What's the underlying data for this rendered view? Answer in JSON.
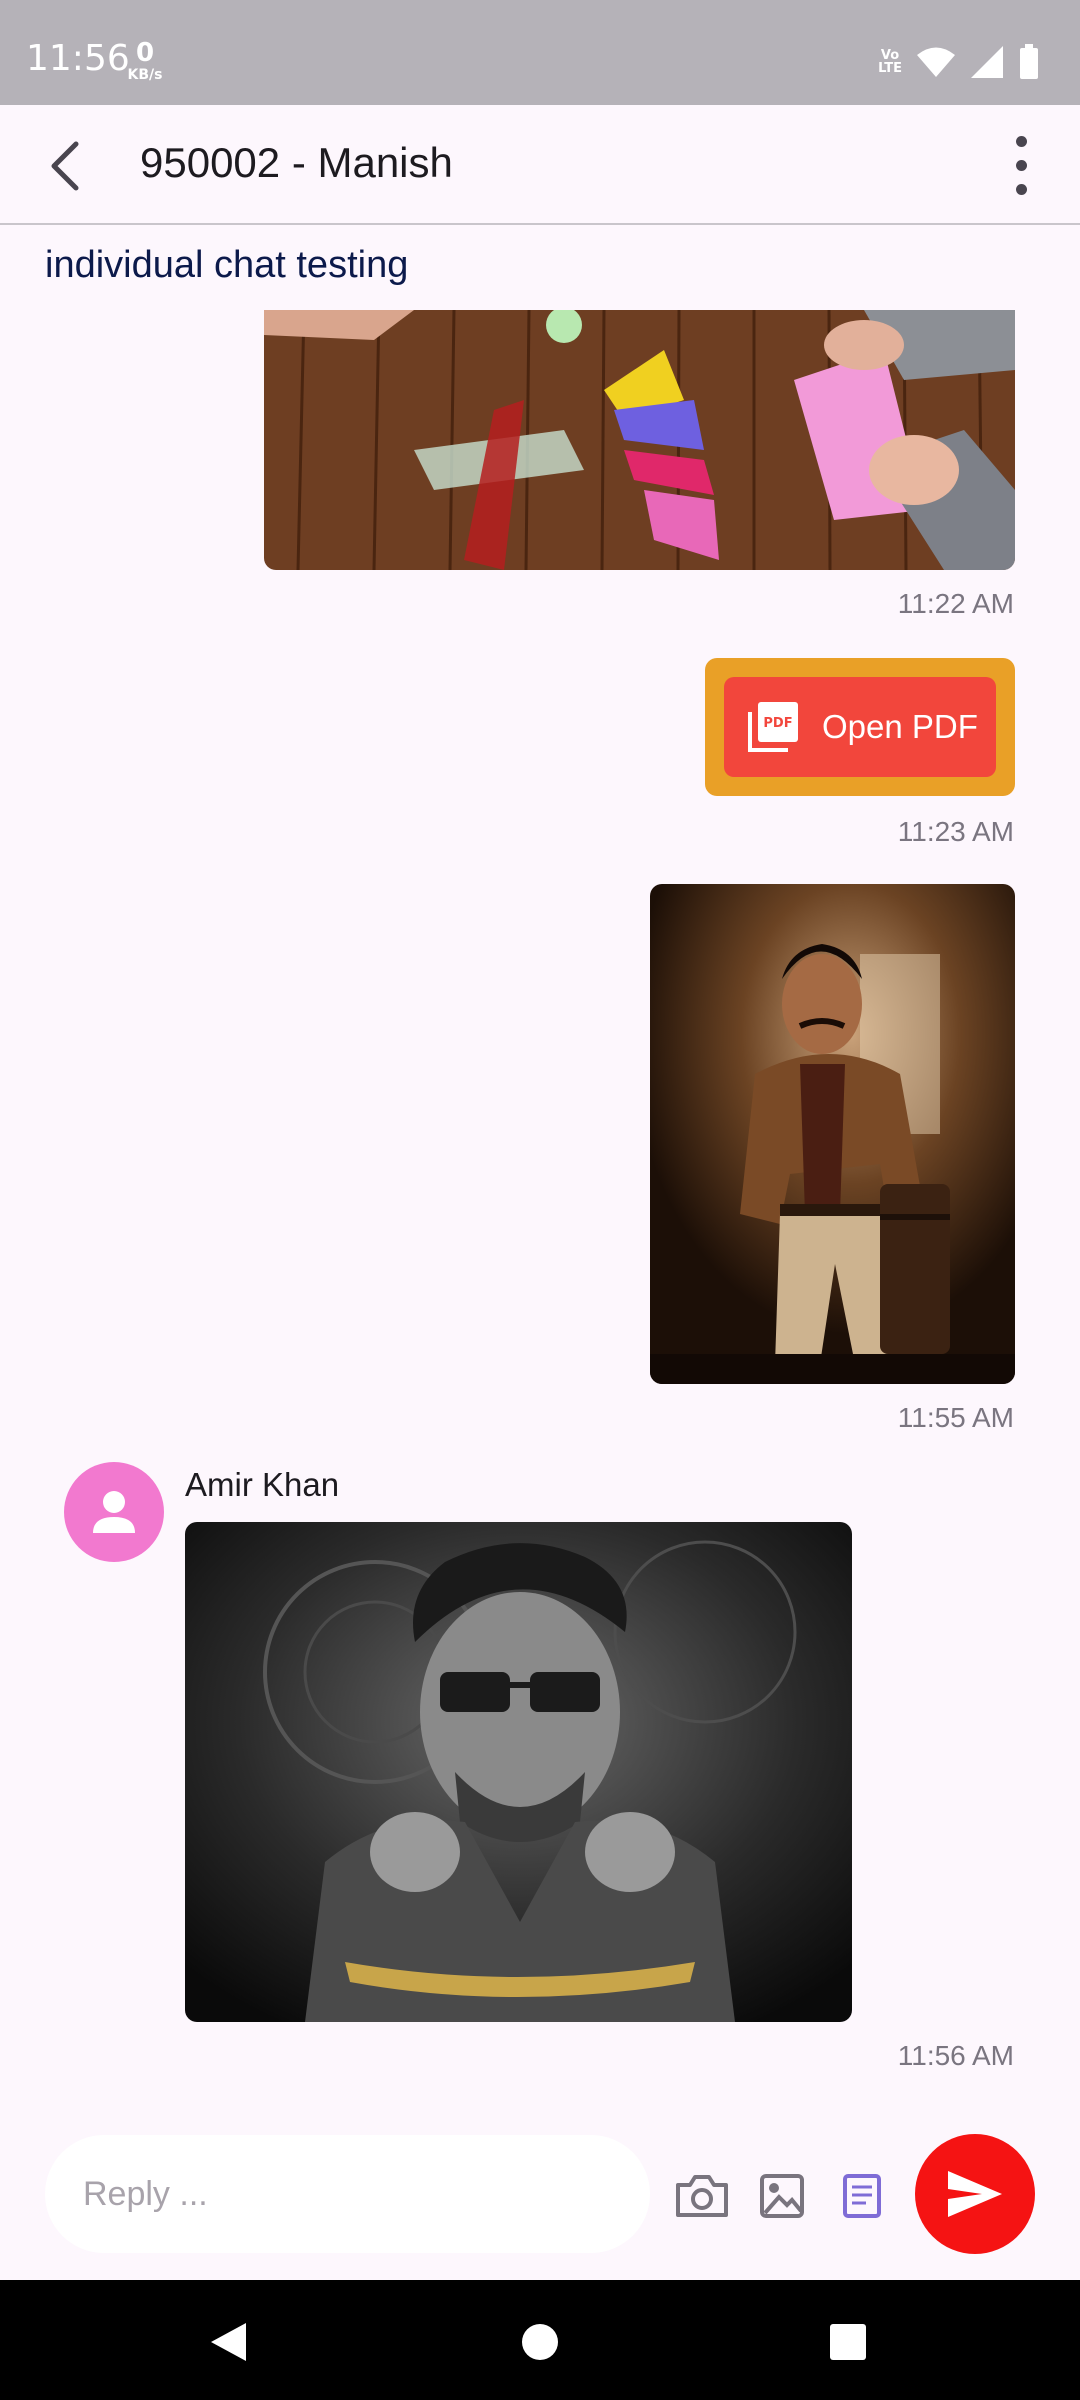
{
  "status_bar": {
    "time": "11:56",
    "net_speed_value": "0",
    "net_speed_unit": "KB/s",
    "volte_line1": "Vo",
    "volte_line2": "LTE"
  },
  "header": {
    "title": "950002 - Manish",
    "back_icon": "chevron-left-icon",
    "menu_icon": "more-vertical-icon"
  },
  "chat": {
    "subtitle": "individual chat testing",
    "messages": [
      {
        "kind": "image",
        "timestamp": "11:22 AM"
      },
      {
        "kind": "pdf",
        "button_label": "Open PDF",
        "icon_text": "PDF",
        "timestamp": "11:23 AM"
      },
      {
        "kind": "image",
        "timestamp": "11:55 AM"
      },
      {
        "kind": "image",
        "sender": "Amir Khan",
        "timestamp": "11:56 AM"
      }
    ]
  },
  "composer": {
    "placeholder": "Reply ...",
    "camera_icon": "camera-icon",
    "gallery_icon": "image-icon",
    "document_icon": "document-icon",
    "send_icon": "send-icon"
  },
  "colors": {
    "accent_send": "#f51313",
    "pdf_outer": "#e9a027",
    "pdf_inner": "#f2463c",
    "avatar": "#f279cf",
    "background": "#fdf7fd"
  }
}
